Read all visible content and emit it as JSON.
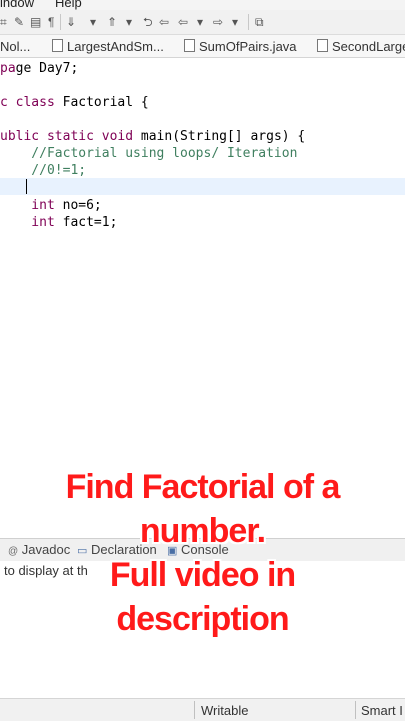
{
  "menubar": {
    "items": [
      "indow",
      "Help"
    ]
  },
  "tabs": [
    {
      "label": "Nol..."
    },
    {
      "label": "LargestAndSm..."
    },
    {
      "label": "SumOfPairs.java"
    },
    {
      "label": "SecondLarge"
    }
  ],
  "code": {
    "line1": "ge Day7;",
    "line2_kw": "c class",
    "line2_rest": " Factorial {",
    "line3_kw": "ublic static void",
    "line3_rest": " main(String[] args) {",
    "line4": "    //Factorial using loops/ Iteration",
    "line5": "    //0!=1;",
    "line7_kw": "    int",
    "line7_rest": " no=6;",
    "line8_kw": "    int",
    "line8_rest": " fact=1;"
  },
  "panel": {
    "tabs": [
      "Javadoc",
      "Declaration",
      "Console"
    ],
    "console_message": "to display at th"
  },
  "status": {
    "writable": "Writable",
    "insert_mode": "Smart I"
  },
  "caption": {
    "line1": "Find Factorial of a",
    "line2": "number.",
    "line3": "Full video in",
    "line4": "description"
  }
}
